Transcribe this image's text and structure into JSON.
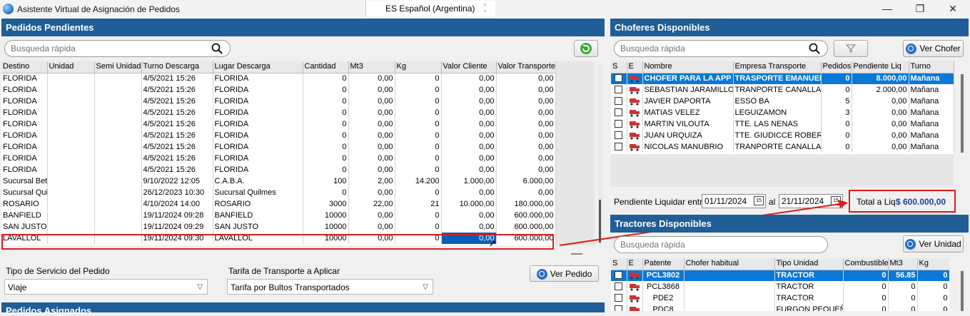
{
  "window": {
    "title": "Asistente Virtual de Asignación de Pedidos",
    "language": "ES Español (Argentina)",
    "minimize": "—",
    "restore": "❐",
    "close": "✕"
  },
  "pedidos": {
    "header": "Pedidos Pendientes",
    "search_placeholder": "Busqueda rápida",
    "columns": [
      "Destino",
      "Unidad",
      "Semi Unidad",
      "Turno Descarga",
      "Lugar Descarga",
      "Cantidad",
      "Mt3",
      "Kg",
      "Valor Cliente",
      "Valor Transporte"
    ],
    "rows": [
      [
        "FLORIDA",
        "",
        "",
        "4/5/2021 15:26",
        "FLORIDA",
        "0",
        "0,00",
        "0",
        "0,00",
        "0,00"
      ],
      [
        "FLORIDA",
        "",
        "",
        "4/5/2021 15:26",
        "FLORIDA",
        "0",
        "0,00",
        "0",
        "0,00",
        "0,00"
      ],
      [
        "FLORIDA",
        "",
        "",
        "4/5/2021 15:26",
        "FLORIDA",
        "0",
        "0,00",
        "0",
        "0,00",
        "0,00"
      ],
      [
        "FLORIDA",
        "",
        "",
        "4/5/2021 15:26",
        "FLORIDA",
        "0",
        "0,00",
        "0",
        "0,00",
        "0,00"
      ],
      [
        "FLORIDA",
        "",
        "",
        "4/5/2021 15:26",
        "FLORIDA",
        "0",
        "0,00",
        "0",
        "0,00",
        "0,00"
      ],
      [
        "FLORIDA",
        "",
        "",
        "4/5/2021 15:26",
        "FLORIDA",
        "0",
        "0,00",
        "0",
        "0,00",
        "0,00"
      ],
      [
        "FLORIDA",
        "",
        "",
        "4/5/2021 15:26",
        "FLORIDA",
        "0",
        "0,00",
        "0",
        "0,00",
        "0,00"
      ],
      [
        "FLORIDA",
        "",
        "",
        "4/5/2021 15:26",
        "FLORIDA",
        "0",
        "0,00",
        "0",
        "0,00",
        "0,00"
      ],
      [
        "FLORIDA",
        "",
        "",
        "4/5/2021 15:26",
        "FLORIDA",
        "0",
        "0,00",
        "0",
        "0,00",
        "0,00"
      ],
      [
        "Sucursal Beta",
        "",
        "",
        "9/10/2022 12:05",
        "C.A.B.A.",
        "100",
        "2,00",
        "14.200",
        "1.000,00",
        "6.000,00"
      ],
      [
        "Sucursal Quilmes",
        "",
        "",
        "26/12/2023 10:30",
        "Sucursal Quilmes",
        "0",
        "0,00",
        "0",
        "0,00",
        "0,00"
      ],
      [
        "ROSARIO",
        "",
        "",
        "4/10/2024 14:00",
        "ROSARIO",
        "3000",
        "22,00",
        "21",
        "10.000,00",
        "180.000,00"
      ],
      [
        "BANFIELD",
        "",
        "",
        "19/11/2024 09:28",
        "BANFIELD",
        "10000",
        "0,00",
        "0",
        "0,00",
        "600.000,00"
      ],
      [
        "SAN JUSTO",
        "",
        "",
        "19/11/2024 09:29",
        "SAN JUSTO",
        "10000",
        "0,00",
        "0",
        "0,00",
        "600.000,00"
      ],
      [
        "LAVALLOL",
        "",
        "",
        "19/11/2024 09:30",
        "LAVALLOL",
        "10000",
        "0,00",
        "0",
        "0,00",
        "600.000,00"
      ]
    ],
    "tipo_servicio_label": "Tipo de Servicio del Pedido",
    "tipo_servicio_value": "Viaje",
    "tarifa_label": "Tarifa de Transporte a Aplicar",
    "tarifa_value": "Tarifa por Bultos Transportados",
    "ver_pedido": "Ver Pedido",
    "asignados_header": "Pedidos Asignados"
  },
  "choferes": {
    "header": "Choferes Disponibles",
    "search_placeholder": "Busqueda rápida",
    "ver_chofer": "Ver Chofer",
    "columns": [
      "S",
      "E",
      "Nombre",
      "Empresa Transporte",
      "Pedidos",
      "Pendiente Liq",
      "Turno"
    ],
    "rows": [
      [
        "CHOFER PARA LA APP",
        "TRASPORTE EMANUEL",
        "0",
        "8.000,00",
        "Mañana"
      ],
      [
        "SEBASTIAN JARAMILLO",
        "TRANPORTE CANALLA",
        "0",
        "2.000,00",
        "Mañana"
      ],
      [
        "JAVIER DAPORTA",
        "ESSO BA",
        "5",
        "0,00",
        "Mañana"
      ],
      [
        "MATIAS VELEZ",
        "LEGUIZAMON",
        "3",
        "0,00",
        "Mañana"
      ],
      [
        "MARTIN VILOUTA",
        "TTE. LAS NENAS",
        "0",
        "0,00",
        "Mañana"
      ],
      [
        "JUAN URQUIZA",
        "TTE. GIUDICCE ROBERTO",
        "0",
        "0,00",
        "Mañana"
      ],
      [
        "NICOLAS MANUBRIO",
        "TRANPORTE CANALLA",
        "0",
        "0,00",
        "Mañana"
      ]
    ],
    "pendiente_label": "Pendiente Liquidar entre",
    "fecha_desde": "01/11/2024",
    "al_label": "al",
    "fecha_hasta": "21/11/2024",
    "total_label": "Total a Liq",
    "total_value": "$ 600.000,00",
    "cal_icon_text": "15"
  },
  "tractores": {
    "header": "Tractores Disponibles",
    "search_placeholder": "Busqueda rápida",
    "ver_unidad": "Ver Unidad",
    "columns": [
      "S",
      "E",
      "Patente",
      "Chofer habitual",
      "Tipo Unidad",
      "Combustible",
      "Mt3",
      "Kg"
    ],
    "rows": [
      [
        "PCL3802",
        "",
        "TRACTOR",
        "0",
        "56.85",
        "0"
      ],
      [
        "PCL3868",
        "",
        "TRACTOR",
        "0",
        "0",
        "0"
      ],
      [
        "PDE2",
        "",
        "TRACTOR",
        "0",
        "0",
        "0"
      ],
      [
        "PDC8",
        "",
        "FURGON PEQUEÑO",
        "0",
        "0",
        "0"
      ]
    ]
  },
  "colors": {
    "header_blue": "#1f5e96",
    "selection_blue": "#0a78d7",
    "highlight_red": "#e01a1a",
    "total_blue": "#1a3fa0"
  }
}
